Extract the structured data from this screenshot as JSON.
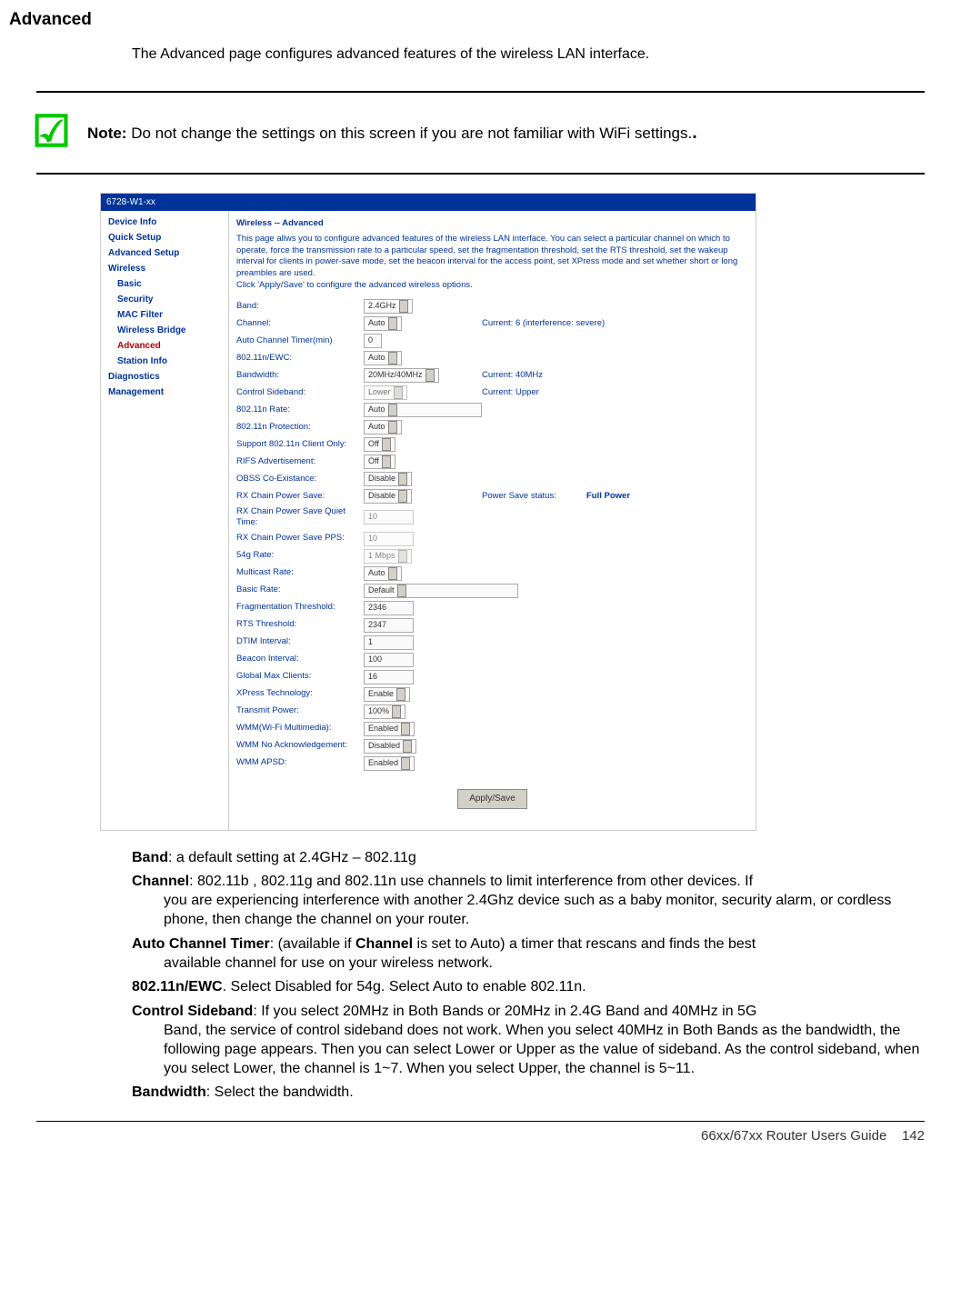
{
  "heading": "Advanced",
  "intro": "The Advanced page configures advanced features of the wireless LAN interface.",
  "note": {
    "label": "Note:",
    "text": "Do not change the settings on this screen if you are not familiar with WiFi settings."
  },
  "screenshot": {
    "modelHeader": "6728-W1-xx",
    "nav": {
      "deviceInfo": "Device Info",
      "quickSetup": "Quick Setup",
      "advancedSetup": "Advanced Setup",
      "wireless": "Wireless",
      "basic": "Basic",
      "security": "Security",
      "macFilter": "MAC Filter",
      "wirelessBridge": "Wireless Bridge",
      "advanced": "Advanced",
      "stationInfo": "Station Info",
      "diagnostics": "Diagnostics",
      "management": "Management"
    },
    "mainHeading": "Wireless -- Advanced",
    "mainIntro": "This page allws you to configure advanced features of the wireless LAN interface. You can select a particular channel on which to operate, force the transmission rate to a particular speed, set the fragmentation threshold, set the RTS threshold, set the wakeup interval for clients in power-save mode, set the beacon interval for the access point, set XPress mode and set whether short or long preambles are used.",
    "mainIntroLine2": "Click 'Apply/Save' to configure the advanced wireless options.",
    "fields": {
      "band": {
        "label": "Band:",
        "value": "2.4GHz"
      },
      "channel": {
        "label": "Channel:",
        "value": "Auto",
        "status": "Current: 6 (interference: severe)"
      },
      "autoChannelTimer": {
        "label": "Auto Channel Timer(min)",
        "value": "0"
      },
      "n_ewc": {
        "label": "802.11n/EWC:",
        "value": "Auto"
      },
      "bandwidth": {
        "label": "Bandwidth:",
        "value": "20MHz/40MHz",
        "status": "Current: 40MHz"
      },
      "controlSideband": {
        "label": "Control Sideband:",
        "value": "Lower",
        "status": "Current: Upper"
      },
      "nRate": {
        "label": "802.11n Rate:",
        "value": "Auto"
      },
      "nProtection": {
        "label": "802.11n Protection:",
        "value": "Auto"
      },
      "clientOnly": {
        "label": "Support 802.11n Client Only:",
        "value": "Off"
      },
      "rifs": {
        "label": "RIFS Advertisement:",
        "value": "Off"
      },
      "obss": {
        "label": "OBSS Co-Existance:",
        "value": "Disable"
      },
      "rxPowerSave": {
        "label": "RX Chain Power Save:",
        "value": "Disable",
        "statusLabel": "Power Save status:",
        "statusValue": "Full Power"
      },
      "rxQuietTime": {
        "label": "RX Chain Power Save Quiet Time:",
        "value": "10"
      },
      "rxPps": {
        "label": "RX Chain Power Save PPS:",
        "value": "10"
      },
      "rate54g": {
        "label": "54g Rate:",
        "value": "1 Mbps"
      },
      "multicast": {
        "label": "Multicast Rate:",
        "value": "Auto"
      },
      "basicRate": {
        "label": "Basic Rate:",
        "value": "Default"
      },
      "fragThreshold": {
        "label": "Fragmentation Threshold:",
        "value": "2346"
      },
      "rts": {
        "label": "RTS Threshold:",
        "value": "2347"
      },
      "dtim": {
        "label": "DTIM Interval:",
        "value": "1"
      },
      "beacon": {
        "label": "Beacon Interval:",
        "value": "100"
      },
      "maxClients": {
        "label": "Global Max Clients:",
        "value": "16"
      },
      "xpress": {
        "label": "XPress Technology:",
        "value": "Enable"
      },
      "txPower": {
        "label": "Transmit Power:",
        "value": "100%"
      },
      "wmm": {
        "label": "WMM(Wi-Fi Multimedia):",
        "value": "Enabled"
      },
      "wmmNoAck": {
        "label": "WMM No Acknowledgement:",
        "value": "Disabled"
      },
      "wmmApsd": {
        "label": "WMM APSD:",
        "value": "Enabled"
      }
    },
    "applySave": "Apply/Save"
  },
  "definitions": {
    "band": {
      "term": "Band",
      "text": ": a default setting at 2.4GHz – 802.11g"
    },
    "channel": {
      "term": "Channel",
      "text": ": 802.11b , 802.11g and 802.11n use channels to limit interference from other devices. If",
      "cont": "you are experiencing interference with another 2.4Ghz device such as a baby monitor, security alarm, or cordless phone, then change the channel on your router."
    },
    "autoTimer": {
      "term": "Auto Channel Timer",
      "text": ": (available if ",
      "term2": "Channel",
      "text2": " is set to Auto) a timer that rescans and finds the best",
      "cont": "available channel for use on your wireless network."
    },
    "nEwc": {
      "term": "802.11n/EWC",
      "text": ". Select Disabled for 54g. Select Auto to enable 802.11n."
    },
    "controlSideband": {
      "term": "Control Sideband",
      "text": ": If you select 20MHz in Both Bands or 20MHz in 2.4G Band and 40MHz in 5G",
      "cont": "Band, the service of control sideband does not work. When you select 40MHz in Both Bands as the bandwidth, the following page appears. Then you can select Lower or Upper as the value of sideband. As the control sideband, when you select Lower, the channel is 1~7. When you select Upper, the channel is 5~11."
    },
    "bandwidth": {
      "term": "Bandwidth",
      "text": ": Select the bandwidth."
    }
  },
  "footer": {
    "guide": "66xx/67xx Router Users Guide",
    "page": "142"
  }
}
